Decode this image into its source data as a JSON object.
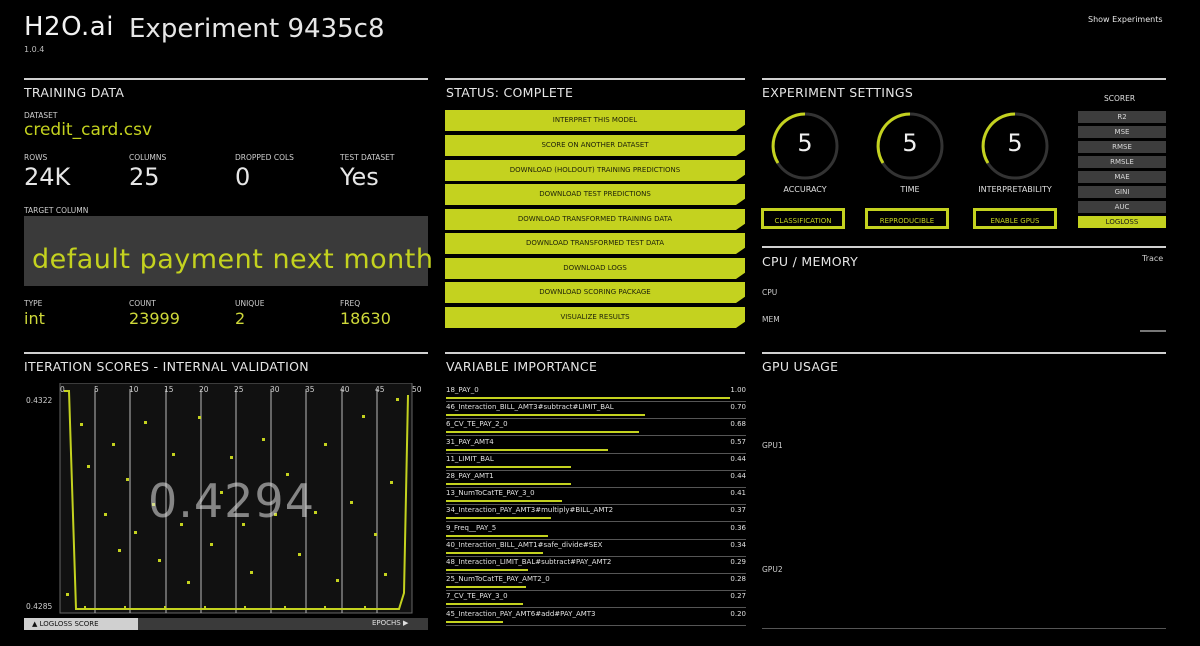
{
  "header": {
    "logo": "H2O.ai",
    "version": "1.0.4",
    "experiment_title": "Experiment 9435c8",
    "show_experiments": "Show Experiments"
  },
  "training_data": {
    "title": "TRAINING DATA",
    "dataset_label": "DATASET",
    "dataset": "credit_card.csv",
    "rows_label": "ROWS",
    "rows": "24K",
    "columns_label": "COLUMNS",
    "columns": "25",
    "dropped_label": "DROPPED COLS",
    "dropped": "0",
    "test_label": "TEST DATASET",
    "test": "Yes",
    "target_label": "TARGET COLUMN",
    "target": "default payment next month",
    "type_label": "TYPE",
    "type": "int",
    "count_label": "COUNT",
    "count": "23999",
    "unique_label": "UNIQUE",
    "unique": "2",
    "freq_label": "FREQ",
    "freq": "18630"
  },
  "status": {
    "title": "STATUS: COMPLETE",
    "buttons": [
      "INTERPRET THIS MODEL",
      "SCORE ON ANOTHER DATASET",
      "DOWNLOAD (HOLDOUT) TRAINING PREDICTIONS",
      "DOWNLOAD TEST PREDICTIONS",
      "DOWNLOAD TRANSFORMED TRAINING DATA",
      "DOWNLOAD TRANSFORMED TEST DATA",
      "DOWNLOAD LOGS",
      "DOWNLOAD SCORING PACKAGE",
      "VISUALIZE RESULTS"
    ]
  },
  "settings": {
    "title": "EXPERIMENT SETTINGS",
    "accuracy_label": "ACCURACY",
    "accuracy": "5",
    "time_label": "TIME",
    "time": "5",
    "interp_label": "INTERPRETABILITY",
    "interp": "5",
    "classification": "CLASSIFICATION",
    "reproducible": "REPRODUCIBLE",
    "enable_gpus": "ENABLE GPUS",
    "scorer_title": "SCORER",
    "scorers": [
      "R2",
      "MSE",
      "RMSE",
      "RMSLE",
      "MAE",
      "GINI",
      "AUC",
      "LOGLOSS"
    ],
    "active_scorer": "LOGLOSS"
  },
  "resources": {
    "title": "CPU / MEMORY",
    "trace": "Trace",
    "cpu": "CPU",
    "mem": "MEM"
  },
  "iteration": {
    "title": "ITERATION SCORES - INTERNAL VALIDATION",
    "y_top": "0.4322",
    "y_bottom": "0.4285",
    "big_value": "0.4294",
    "x_ticks": [
      "0",
      "5",
      "10",
      "15",
      "20",
      "25",
      "30",
      "35",
      "40",
      "45",
      "50"
    ],
    "legend_left": "▲ LOGLOSS SCORE",
    "epochs": "EPOCHS ▶"
  },
  "variable_importance": {
    "title": "VARIABLE IMPORTANCE",
    "items": [
      {
        "name": "18_PAY_0",
        "value": "1.00",
        "frac": 1.0
      },
      {
        "name": "46_Interaction_BILL_AMT3#subtract#LIMIT_BAL",
        "value": "0.70",
        "frac": 0.7
      },
      {
        "name": "6_CV_TE_PAY_2_0",
        "value": "0.68",
        "frac": 0.68
      },
      {
        "name": "31_PAY_AMT4",
        "value": "0.57",
        "frac": 0.57
      },
      {
        "name": "11_LIMIT_BAL",
        "value": "0.44",
        "frac": 0.44
      },
      {
        "name": "28_PAY_AMT1",
        "value": "0.44",
        "frac": 0.44
      },
      {
        "name": "13_NumToCatTE_PAY_3_0",
        "value": "0.41",
        "frac": 0.41
      },
      {
        "name": "34_Interaction_PAY_AMT3#multiply#BILL_AMT2",
        "value": "0.37",
        "frac": 0.37
      },
      {
        "name": "9_Freq__PAY_5",
        "value": "0.36",
        "frac": 0.36
      },
      {
        "name": "40_Interaction_BILL_AMT1#safe_divide#SEX",
        "value": "0.34",
        "frac": 0.34
      },
      {
        "name": "48_Interaction_LIMIT_BAL#subtract#PAY_AMT2",
        "value": "0.29",
        "frac": 0.29
      },
      {
        "name": "25_NumToCatTE_PAY_AMT2_0",
        "value": "0.28",
        "frac": 0.28
      },
      {
        "name": "7_CV_TE_PAY_3_0",
        "value": "0.27",
        "frac": 0.27
      },
      {
        "name": "45_Interaction_PAY_AMT6#add#PAY_AMT3",
        "value": "0.20",
        "frac": 0.2
      }
    ]
  },
  "gpu": {
    "title": "GPU USAGE",
    "gpu1": "GPU1",
    "gpu2": "GPU2"
  }
}
